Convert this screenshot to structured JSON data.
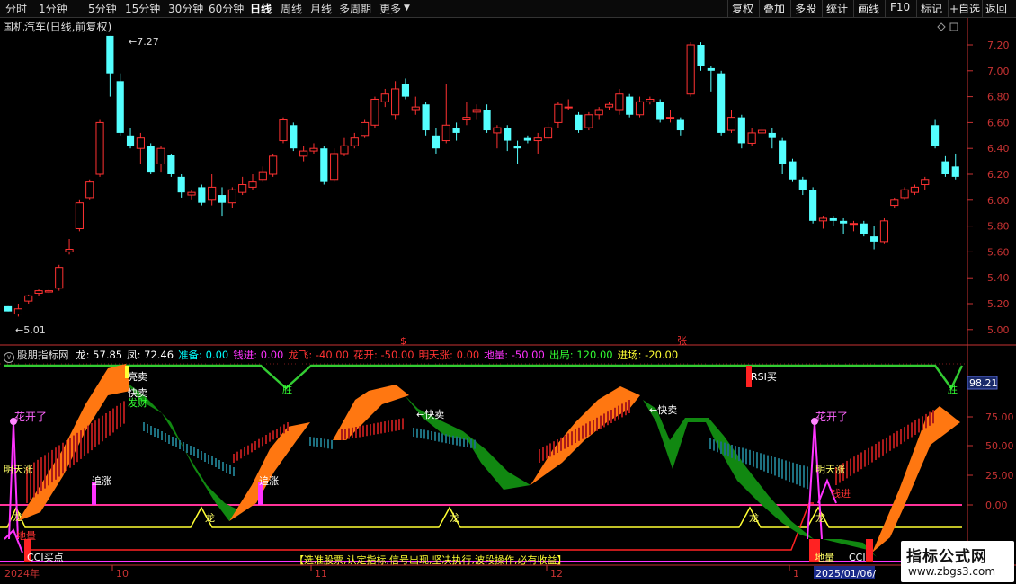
{
  "toolbar": {
    "periods": [
      "分时",
      "1分钟",
      "5分钟",
      "15分钟",
      "30分钟",
      "60分钟",
      "日线",
      "周线",
      "月线",
      "多周期",
      "更多"
    ],
    "active_period": "日线",
    "right_buttons": [
      "复权",
      "叠加",
      "多股",
      "统计",
      "画线",
      "F10",
      "标记",
      "+自选",
      "返回"
    ]
  },
  "stock": {
    "title": "国机汽车(日线,前复权)",
    "high_label": "7.27",
    "low_label": "5.01",
    "marker_dollar": "$",
    "marker_zhang": "张"
  },
  "price_axis": {
    "ticks": [
      "7.20",
      "7.00",
      "6.80",
      "6.60",
      "6.40",
      "6.20",
      "6.00",
      "5.80",
      "5.60",
      "5.40",
      "5.20",
      "5.00"
    ]
  },
  "indicator": {
    "name": "股朋指标网",
    "fields": [
      {
        "label": "龙:",
        "value": "57.85",
        "color": "#ffffff"
      },
      {
        "label": "凤:",
        "value": "72.46",
        "color": "#ffffff"
      },
      {
        "label": "准备:",
        "value": "0.00",
        "color": "#00ffff"
      },
      {
        "label": "钱进:",
        "value": "0.00",
        "color": "#ff33ff"
      },
      {
        "label": "龙飞:",
        "value": "-40.00",
        "color": "#ff3333"
      },
      {
        "label": "花开:",
        "value": "-50.00",
        "color": "#ff3333"
      },
      {
        "label": "明天涨:",
        "value": "0.00",
        "color": "#ff3333"
      },
      {
        "label": "地量:",
        "value": "-50.00",
        "color": "#ff33ff"
      },
      {
        "label": "出局:",
        "value": "120.00",
        "color": "#33ff33"
      },
      {
        "label": "进场:",
        "value": "-20.00",
        "color": "#ffff33"
      }
    ],
    "axis_ticks": [
      "75.00",
      "50.00",
      "25.00",
      "0.00"
    ],
    "current_value": "98.21",
    "labels": {
      "liang_mai": "亮卖",
      "kuai_mai": "快卖",
      "fa_cai": "发财",
      "kuai_mai_arrow": "←快卖",
      "hua_kai": "花开了",
      "ming_tian_zhang": "明天涨",
      "zhui_zhang": "追涨",
      "long": "龙",
      "rsi_buy": "RSI买",
      "qian_jin": "钱进",
      "di_liang": "地量",
      "cci_buy": "CCI买点",
      "cci": "CCI",
      "sheng": "胜",
      "slogan": "【选准股票,认定指标,信号出现,坚决执行,波段操作,必有收益】"
    }
  },
  "date_axis": {
    "labels": [
      "2024年",
      "10",
      "11",
      "12",
      "1",
      "2025/01/06/"
    ]
  },
  "watermark": {
    "title": "指标公式网",
    "url": "www.zbgs3.com"
  },
  "colors": {
    "up": "#ff3232",
    "down": "#54ffff",
    "axis_red": "#c83232",
    "grid": "#7a1a1a"
  }
}
